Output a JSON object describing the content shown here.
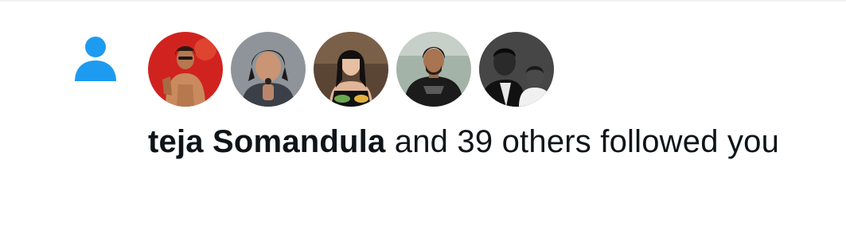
{
  "colors": {
    "accent": "#1d9bf0",
    "text": "#0f1419",
    "divider": "#eff3f4"
  },
  "notification": {
    "type_icon": "person-icon",
    "avatars": [
      {
        "icon": "avatar-shirtless-man-red-bg"
      },
      {
        "icon": "avatar-man-long-hair"
      },
      {
        "icon": "avatar-woman-dark-hair"
      },
      {
        "icon": "avatar-man-black-tshirt"
      },
      {
        "icon": "avatar-black-and-white-portrait"
      }
    ],
    "user_name": "teja Somandula",
    "message_rest": " and 39 others followed you"
  }
}
